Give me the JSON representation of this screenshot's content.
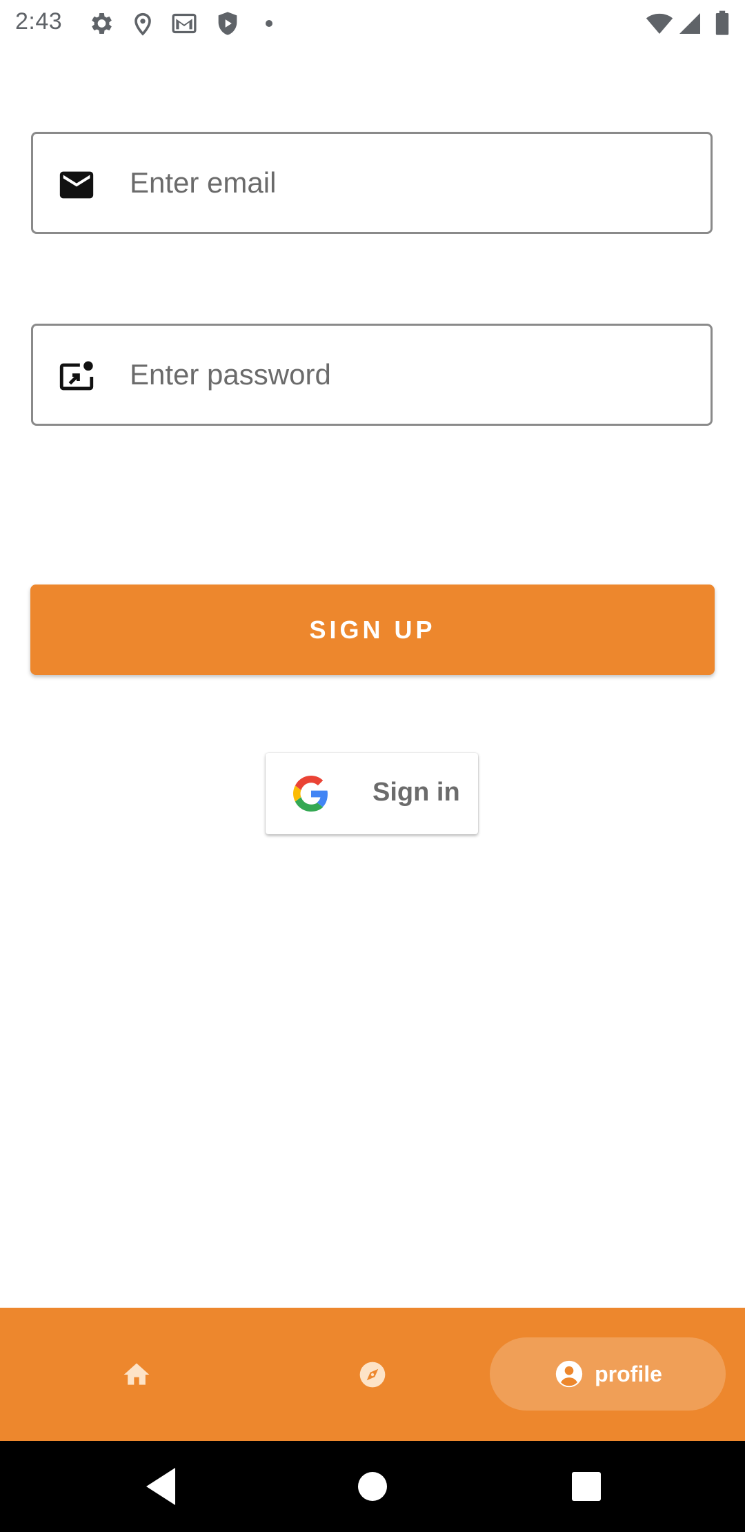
{
  "status_bar": {
    "time": "2:43",
    "left_icons": [
      "settings-icon",
      "location-icon",
      "gmail-icon",
      "shield-play-icon",
      "notification-dot-icon"
    ],
    "right_icons": [
      "wifi-icon",
      "cellular-signal-icon",
      "battery-icon"
    ]
  },
  "form": {
    "email": {
      "placeholder": "Enter email",
      "value": "",
      "icon": "mail-icon"
    },
    "password": {
      "placeholder": "Enter password",
      "value": "",
      "icon": "password-icon"
    },
    "signup_label": "SIGN UP",
    "google_signin_label": "Sign in"
  },
  "bottom_nav": {
    "items": [
      {
        "icon": "home-icon",
        "label": "",
        "selected": false
      },
      {
        "icon": "explore-icon",
        "label": "",
        "selected": false
      },
      {
        "icon": "profile-icon",
        "label": "profile",
        "selected": true
      }
    ]
  },
  "system_nav": {
    "buttons": [
      "back-icon",
      "home-circle-icon",
      "recents-icon"
    ]
  },
  "colors": {
    "accent": "#ed872d",
    "text_primary": "#1f1f1f",
    "text_secondary": "#6b6b6b",
    "border": "#8a8a8a",
    "system_nav_bg": "#000000"
  }
}
